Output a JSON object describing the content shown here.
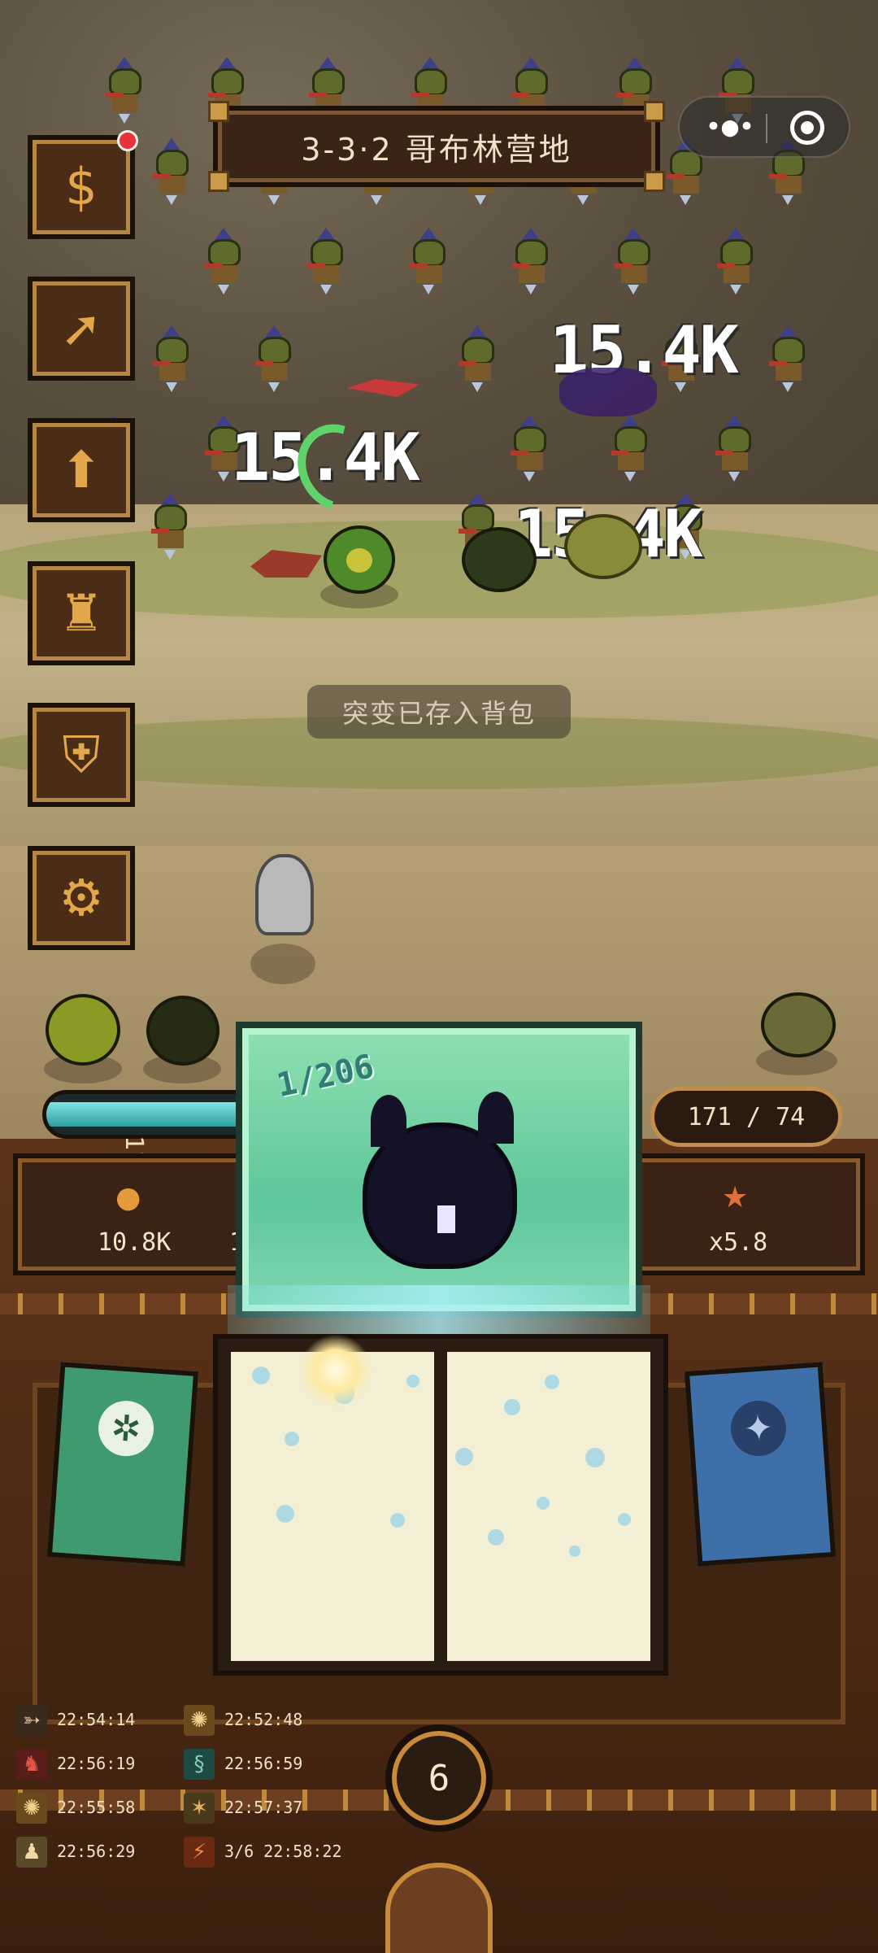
{
  "stage": {
    "title": "3-3·2 哥布林营地"
  },
  "capsule": {
    "more_icon": "•●•",
    "close_icon": "target-close-icon"
  },
  "menu": [
    {
      "name": "bag-button",
      "icon": "money-bag-icon",
      "glyph": "$",
      "badge": true
    },
    {
      "name": "wings-upgrade-button",
      "icon": "wings-icon",
      "glyph": "➚"
    },
    {
      "name": "stairs-button",
      "icon": "stairs-up-icon",
      "glyph": "⬆"
    },
    {
      "name": "tower-button",
      "icon": "tower-icon",
      "glyph": "♜"
    },
    {
      "name": "shield-link-button",
      "icon": "shield-link-icon",
      "glyph": "⛨"
    },
    {
      "name": "settings-button",
      "icon": "gear-wrench-icon",
      "glyph": "⚙"
    }
  ],
  "damage_numbers": [
    "15.4K",
    "15.4K",
    "15.4K"
  ],
  "toast": "突变已存入背包",
  "hp": {
    "fill_fraction": 0.9,
    "number": "118"
  },
  "count": "171 / 74",
  "stats": {
    "left_value": "10.8K",
    "partial_value": "1",
    "right_value": "x5.8"
  },
  "card": {
    "count": "1/206"
  },
  "wave": "6",
  "log": [
    {
      "icon": "bow-icon",
      "time": "22:54:14"
    },
    {
      "icon": "sun-burst-icon",
      "time": "22:52:48"
    },
    {
      "icon": "red-dragon-icon",
      "time": "22:56:19"
    },
    {
      "icon": "serpent-icon",
      "time": "22:56:59"
    },
    {
      "icon": "sun-burst-icon",
      "time": "22:55:58"
    },
    {
      "icon": "spider-icon",
      "time": "22:57:37"
    },
    {
      "icon": "humanoid-icon",
      "time": "22:56:29"
    },
    {
      "icon": "fire-claw-icon",
      "time": "3/6 22:58:22"
    }
  ],
  "colors": {
    "accent": "#c98a3a",
    "card_green": "#7fd7b0",
    "badge_red": "#e8323a"
  }
}
